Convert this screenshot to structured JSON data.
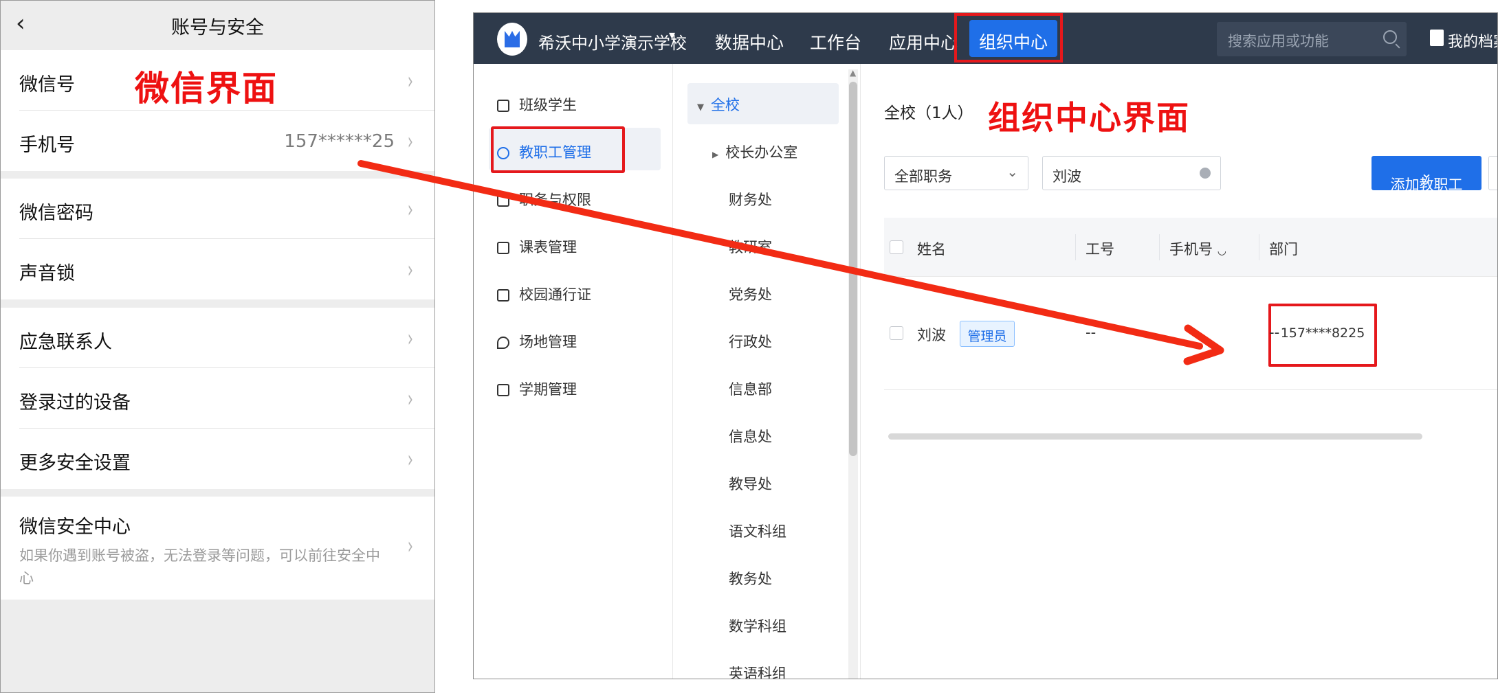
{
  "wechat": {
    "title": "账号与安全",
    "annotation": "微信界面",
    "rows": [
      {
        "label": "微信号",
        "value": ""
      },
      {
        "label": "手机号",
        "value": "157******25"
      },
      {
        "label": "微信密码",
        "value": ""
      },
      {
        "label": "声音锁",
        "value": ""
      },
      {
        "label": "应急联系人",
        "value": ""
      },
      {
        "label": "登录过的设备",
        "value": ""
      },
      {
        "label": "更多安全设置",
        "value": ""
      }
    ],
    "security_center": {
      "label": "微信安全中心",
      "desc": "如果你遇到账号被盗，无法登录等问题，可以前往安全中心"
    }
  },
  "org": {
    "school": "希沃中小学演示学校",
    "nav": [
      "数据中心",
      "工作台",
      "应用中心",
      "组织中心"
    ],
    "search_placeholder": "搜索应用或功能",
    "archive": "我的档案",
    "menu": [
      "班级学生",
      "教职工管理",
      "职务与权限",
      "课表管理",
      "校园通行证",
      "场地管理",
      "学期管理"
    ],
    "tree_root": "全校",
    "tree": [
      "校长办公室",
      "财务处",
      "教研室",
      "党务处",
      "行政处",
      "信息部",
      "信息处",
      "教导处",
      "语文科组",
      "教务处",
      "数学科组",
      "英语科组"
    ],
    "breadcrumb": "全校（1人）",
    "annotation": "组织中心界面",
    "filter_role": "全部职务",
    "filter_name": "刘波",
    "add_button": "添加教职工",
    "columns": [
      "姓名",
      "工号",
      "手机号",
      "部门"
    ],
    "row": {
      "name": "刘波",
      "tag": "管理员",
      "job_no": "--",
      "phone": "157****8225",
      "dept": "--"
    }
  },
  "colors": {
    "accent": "#1f6fe8",
    "annotation": "#e5181c",
    "topbar": "#2e3a4b"
  }
}
